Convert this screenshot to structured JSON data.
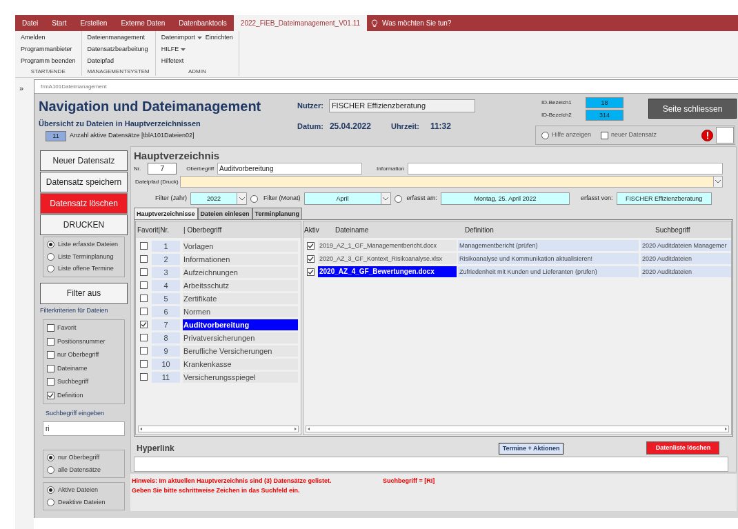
{
  "ribbon": {
    "tabs": [
      {
        "label": "Datei",
        "selected": false
      },
      {
        "label": "Start",
        "selected": false
      },
      {
        "label": "Erstellen",
        "selected": false
      },
      {
        "label": "Externe Daten",
        "selected": false
      },
      {
        "label": "Datenbanktools",
        "selected": false
      },
      {
        "label": "2022_FiEB_Dateimanagement_V01.11",
        "selected": true
      }
    ],
    "tell_me": "Was möchten Sie tun?",
    "groups": [
      {
        "label": "START/ENDE",
        "rows": [
          [
            {
              "label": "Amelden",
              "menu": false
            }
          ],
          [
            {
              "label": "Programmanbieter",
              "menu": false
            }
          ],
          [
            {
              "label": "Programm beenden",
              "menu": false
            }
          ]
        ]
      },
      {
        "label": "MANAGEMENTSYSTEM",
        "rows": [
          [
            {
              "label": "Dateienmanagement",
              "menu": false
            }
          ],
          [
            {
              "label": "Datensatzbearbeitung",
              "menu": false
            }
          ],
          [
            {
              "label": "Dateipfad",
              "menu": false
            }
          ]
        ]
      },
      {
        "label": "ADMIN",
        "rows": [
          [
            {
              "label": "Datenimport",
              "menu": true
            },
            {
              "label": "Einrichten",
              "menu": false
            }
          ],
          [
            {
              "label": "HILFE",
              "menu": true
            }
          ],
          [
            {
              "label": "Hilfetext",
              "menu": false
            }
          ]
        ]
      }
    ]
  },
  "nav_toggle": "»",
  "form": {
    "title": "frmA101Dateimanagement",
    "header": {
      "heading": "Navigation und Dateimanagement",
      "subtitle": "Übersicht zu Dateien in Hauptverzeichnissen",
      "count": "11",
      "count_label": "Anzahl aktive Datensätze [tblA101Dateien02]",
      "nutzer_label": "Nutzer:",
      "nutzer_value": "FISCHER Effizienzberatung",
      "datum_label": "Datum:",
      "datum_value": "25.04.2022",
      "uhrzeit_label": "Uhrzeit:",
      "uhrzeit_value": "11:32",
      "ids": [
        {
          "label": "ID-Bezeich1",
          "value": "18"
        },
        {
          "label": "ID-Bezeich2",
          "value": "314"
        }
      ],
      "close_button": "Seite schliessen",
      "hilfe": {
        "label": "Hilfe anzeigen",
        "selected": false
      },
      "neuer": {
        "label": "neuer Datensatz",
        "checked": false
      }
    },
    "left": {
      "buttons": [
        {
          "label": "Neuer Datensatz",
          "kind": "normal"
        },
        {
          "label": "Datensatz speichern",
          "kind": "normal"
        },
        {
          "label": "Datensatz löschen",
          "kind": "danger"
        },
        {
          "label": "DRUCKEN",
          "kind": "normal"
        }
      ],
      "list_options": [
        {
          "label": "Liste erfasste Dateien",
          "selected": true
        },
        {
          "label": "Liste Terminplanung",
          "selected": false
        },
        {
          "label": "Liste offene Termine",
          "selected": false
        }
      ],
      "filter_button": "Filter aus",
      "filter_caption": "Filterkriterien für Dateien",
      "criteria": [
        {
          "label": "Favorit",
          "checked": false
        },
        {
          "label": "Positionsnummer",
          "checked": false
        },
        {
          "label": "nur Oberbegriff",
          "checked": false
        },
        {
          "label": "Dateiname",
          "checked": false
        },
        {
          "label": "Suchbegriff",
          "checked": false
        },
        {
          "label": "Definition",
          "checked": true
        }
      ],
      "search_label": "Suchbegriff eingeben",
      "search_value": "ri",
      "scope": [
        {
          "label": "nur Oberbegriff",
          "selected": true
        },
        {
          "label": "alle Datensätze",
          "selected": false
        }
      ],
      "status": [
        {
          "label": "Aktive Dateien",
          "selected": true
        },
        {
          "label": "Deaktive Dateien",
          "selected": false
        }
      ]
    },
    "main": {
      "title": "Hauptverzeichnis",
      "nr_label": "Nr.",
      "nr_value": "7",
      "oberbegriff_label": "Oberbegriff",
      "oberbegriff_value": "Auditvorbereitung",
      "information_label": "Information",
      "dateipfad_label": "Dateipfad (Druck)",
      "jahr_label": "Filter (Jahr)",
      "jahr_value": "2022",
      "jahr_option_selected": false,
      "monat_option_selected": false,
      "monat_label": "Filter (Monat)",
      "monat_value": "April",
      "erfasst_am_label": "erfasst am:",
      "erfasst_am_value": "Montag, 25. April 2022",
      "erfasst_von_label": "erfasst von:",
      "erfasst_von_value": "FISCHER Effizienzberatung",
      "tabs": [
        {
          "label": "Hauptverzeichnisse",
          "selected": true
        },
        {
          "label": "Dateien einlesen",
          "selected": false
        },
        {
          "label": "Terminplanung",
          "selected": false
        }
      ],
      "list_header": [
        "Favorit|Nr.",
        "| Oberbegriff"
      ],
      "list": [
        {
          "nr": "1",
          "name": "Vorlagen",
          "favorite": false,
          "selected": false
        },
        {
          "nr": "2",
          "name": "Informationen",
          "favorite": false,
          "selected": false
        },
        {
          "nr": "3",
          "name": "Aufzeichnungen",
          "favorite": false,
          "selected": false
        },
        {
          "nr": "4",
          "name": "Arbeitsschutz",
          "favorite": false,
          "selected": false
        },
        {
          "nr": "5",
          "name": "Zertifikate",
          "favorite": false,
          "selected": false
        },
        {
          "nr": "6",
          "name": "Normen",
          "favorite": false,
          "selected": false
        },
        {
          "nr": "7",
          "name": "Auditvorbereitung",
          "favorite": true,
          "selected": true
        },
        {
          "nr": "8",
          "name": "Privatversicherungen",
          "favorite": false,
          "selected": false
        },
        {
          "nr": "9",
          "name": "Berufliche Versicherungen",
          "favorite": false,
          "selected": false
        },
        {
          "nr": "10",
          "name": "Krankenkasse",
          "favorite": false,
          "selected": false
        },
        {
          "nr": "11",
          "name": "Versicherungsspiegel",
          "favorite": false,
          "selected": false
        }
      ],
      "table_columns": [
        "Aktiv",
        "Dateiname",
        "Definition",
        "Suchbegriff"
      ],
      "files": [
        {
          "aktiv": true,
          "dateiname": "2019_AZ_1_GF_Managementbericht.docx",
          "definition": "Managementbericht (prüfen)",
          "suchbegriff": "2020 Auditdateien Managemer",
          "selected": false
        },
        {
          "aktiv": true,
          "dateiname": "2020_AZ_3_GF_Kontext_Risikoanalyse.xlsx",
          "definition": "Risikoanalyse und Kommunikation aktualisieren!",
          "suchbegriff": "2020 Auditdateien",
          "selected": false
        },
        {
          "aktiv": true,
          "dateiname": "2020_AZ_4_GF_Bewertungen.docx",
          "definition": "Zufriedenheit mit Kunden und Lieferanten (prüfen)",
          "suchbegriff": "2020 Auditdateien",
          "selected": true
        }
      ],
      "hyperlink_label": "Hyperlink",
      "termine_button": "Termine + Aktionen",
      "delete_list_button": "Datenliste löschen",
      "hints": [
        "Hinweis: Im aktuellen Hauptverzeichnis sind (3) Datensätze gelistet.",
        "Geben Sie bitte schrittweise Zeichen in das Suchfeld ein."
      ],
      "search_hint": "Suchbegriff = [RI]"
    }
  }
}
